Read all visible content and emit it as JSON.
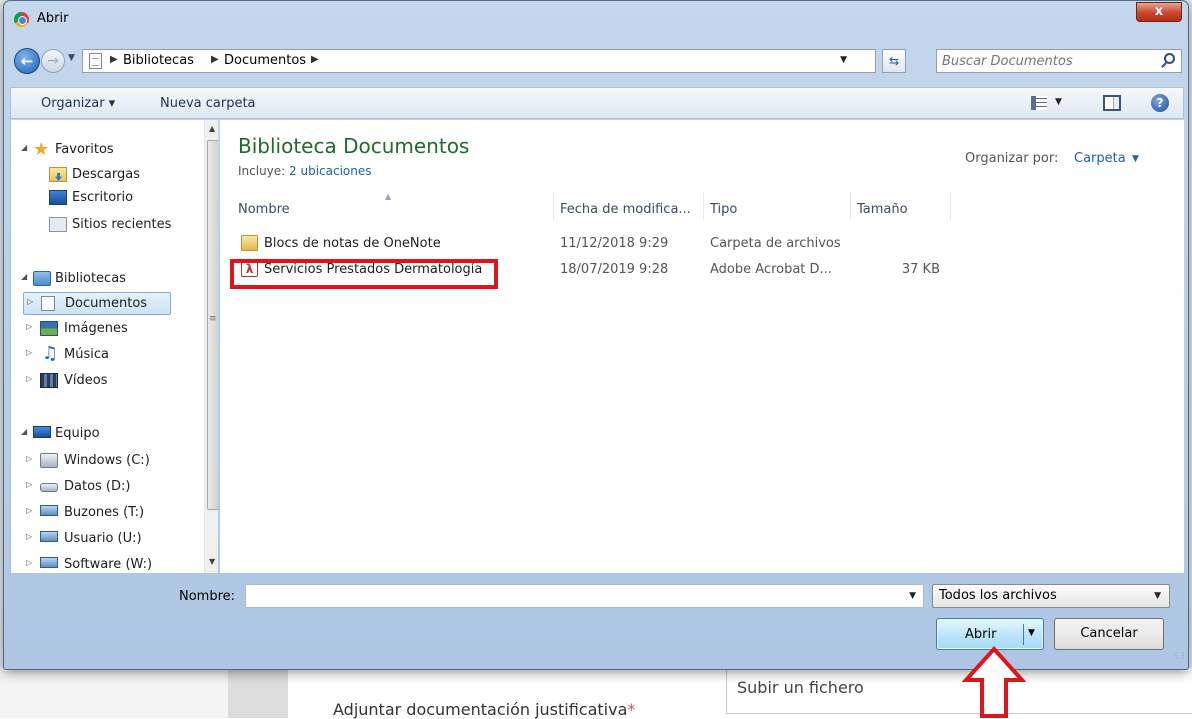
{
  "background_page": {
    "attach_label": "Adjuntar documentación justificativa",
    "required_mark": "*",
    "upload_text": "Subir un fichero"
  },
  "dialog": {
    "title": "Abrir",
    "close_label": "x"
  },
  "address": {
    "breadcrumbs": [
      "Bibliotecas",
      "Documentos"
    ],
    "search_placeholder": "Buscar Documentos"
  },
  "toolbar": {
    "organize_label": "Organizar ▾",
    "new_folder_label": "Nueva carpeta"
  },
  "navigation": {
    "favorites": "Favoritos",
    "downloads": "Descargas",
    "desktop": "Escritorio",
    "recent": "Sitios recientes",
    "libraries": "Bibliotecas",
    "documents": "Documentos",
    "images": "Imágenes",
    "music": "Música",
    "videos": "Vídeos",
    "computer": "Equipo",
    "drives": [
      "Windows (C:)",
      "Datos (D:)",
      "Buzones (T:)",
      "Usuario (U:)",
      "Software (W:)"
    ]
  },
  "library": {
    "title": "Biblioteca Documentos",
    "includes_prefix": "Incluye:",
    "includes_link": "2 ubicaciones",
    "arrange_label": "Organizar por:",
    "arrange_value": "Carpeta"
  },
  "columns": {
    "name": "Nombre",
    "date": "Fecha de modifica...",
    "type": "Tipo",
    "size": "Tamaño"
  },
  "files": [
    {
      "name": "Blocs de notas de OneNote",
      "date": "11/12/2018 9:29",
      "type": "Carpeta de archivos",
      "size": "",
      "icon": "folder-icon"
    },
    {
      "name": "Servicios Prestados Dermatología",
      "date": "18/07/2019 9:28",
      "type": "Adobe Acrobat D...",
      "size": "37 KB",
      "icon": "pdf-icon"
    }
  ],
  "footer": {
    "name_label": "Nombre:",
    "name_value": "",
    "filter_value": "Todos los archivos",
    "open_label": "Abrir",
    "cancel_label": "Cancelar"
  },
  "colors": {
    "annotation_red": "#e0141c",
    "library_title_green": "#1e6b2f",
    "link_blue": "#1a5fb4"
  }
}
